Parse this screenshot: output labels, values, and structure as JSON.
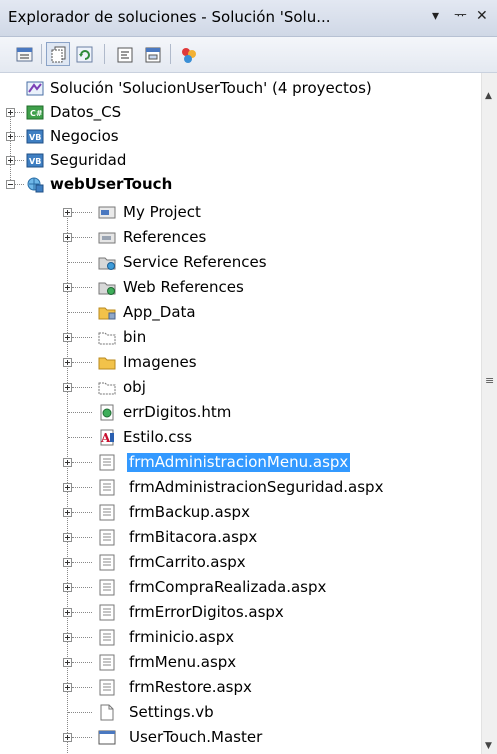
{
  "panel": {
    "title": "Explorador de soluciones - Solución 'Solu...",
    "dropdown_glyph": "▾",
    "pin_glyph": "ᅲ",
    "close_glyph": "✕"
  },
  "toolbar": {
    "buttons": [
      "properties",
      "show-all-files",
      "refresh",
      "view-code",
      "view-designer",
      "class-diagram"
    ]
  },
  "tree": {
    "solution": "Solución 'SolucionUserTouch'  (4 proyectos)",
    "projects": [
      "Datos_CS",
      "Negocios",
      "Seguridad",
      "webUserTouch"
    ],
    "items": [
      "My Project",
      "References",
      "Service References",
      "Web References",
      "App_Data",
      "bin",
      "Imagenes",
      "obj",
      "errDigitos.htm",
      "Estilo.css",
      "frmAdministracionMenu.aspx",
      "frmAdministracionSeguridad.aspx",
      "frmBackup.aspx",
      "frmBitacora.aspx",
      "frmCarrito.aspx",
      "frmCompraRealizada.aspx",
      "frmErrorDigitos.aspx",
      "frminicio.aspx",
      "frmMenu.aspx",
      "frmRestore.aspx",
      "Settings.vb",
      "UserTouch.Master"
    ],
    "selected": "frmAdministracionMenu.aspx"
  },
  "colors": {
    "selection": "#3399ff",
    "folder": "#f2c24a",
    "cs_badge": "#2e8b3a",
    "vb_badge": "#2f6fb3"
  }
}
